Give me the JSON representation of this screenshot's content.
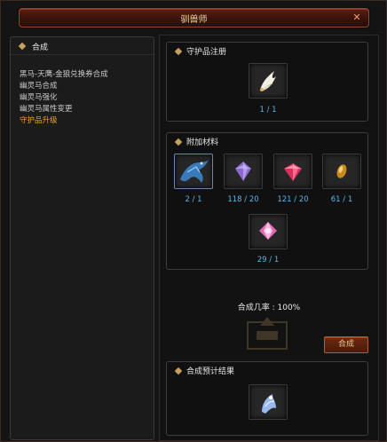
{
  "window": {
    "title": "驯兽师",
    "close_symbol": "✕"
  },
  "left_panel": {
    "header": "合成",
    "menu": [
      {
        "label": "黑马-天鹰-金狼兑换券合成",
        "active": false
      },
      {
        "label": "幽灵马合成",
        "active": false
      },
      {
        "label": "幽灵马强化",
        "active": false
      },
      {
        "label": "幽灵马属性变更",
        "active": false
      },
      {
        "label": "守护品升级",
        "active": true
      }
    ]
  },
  "guardian_section": {
    "title": "守护品注册",
    "slot": {
      "icon": "guardian-wings-icon",
      "count": "1 / 1"
    }
  },
  "materials_section": {
    "title": "附加材料",
    "items": [
      {
        "icon": "blue-dragon-icon",
        "count": "2 / 1"
      },
      {
        "icon": "purple-gem-icon",
        "count": "118 / 20"
      },
      {
        "icon": "red-gem-icon",
        "count": "121 / 20"
      },
      {
        "icon": "gold-capsule-icon",
        "count": "61 / 1"
      },
      {
        "icon": "pink-jewel-icon",
        "count": "29 / 1"
      }
    ]
  },
  "craft": {
    "rate_text": "合成几率 : 100%",
    "button_label": "合成"
  },
  "result_section": {
    "title": "合成预计结果",
    "slot": {
      "icon": "result-guardian-icon"
    }
  },
  "colors": {
    "accent_gold": "#e6a020",
    "count_blue": "#5ab4e8",
    "title_red": "#5a1f16"
  }
}
